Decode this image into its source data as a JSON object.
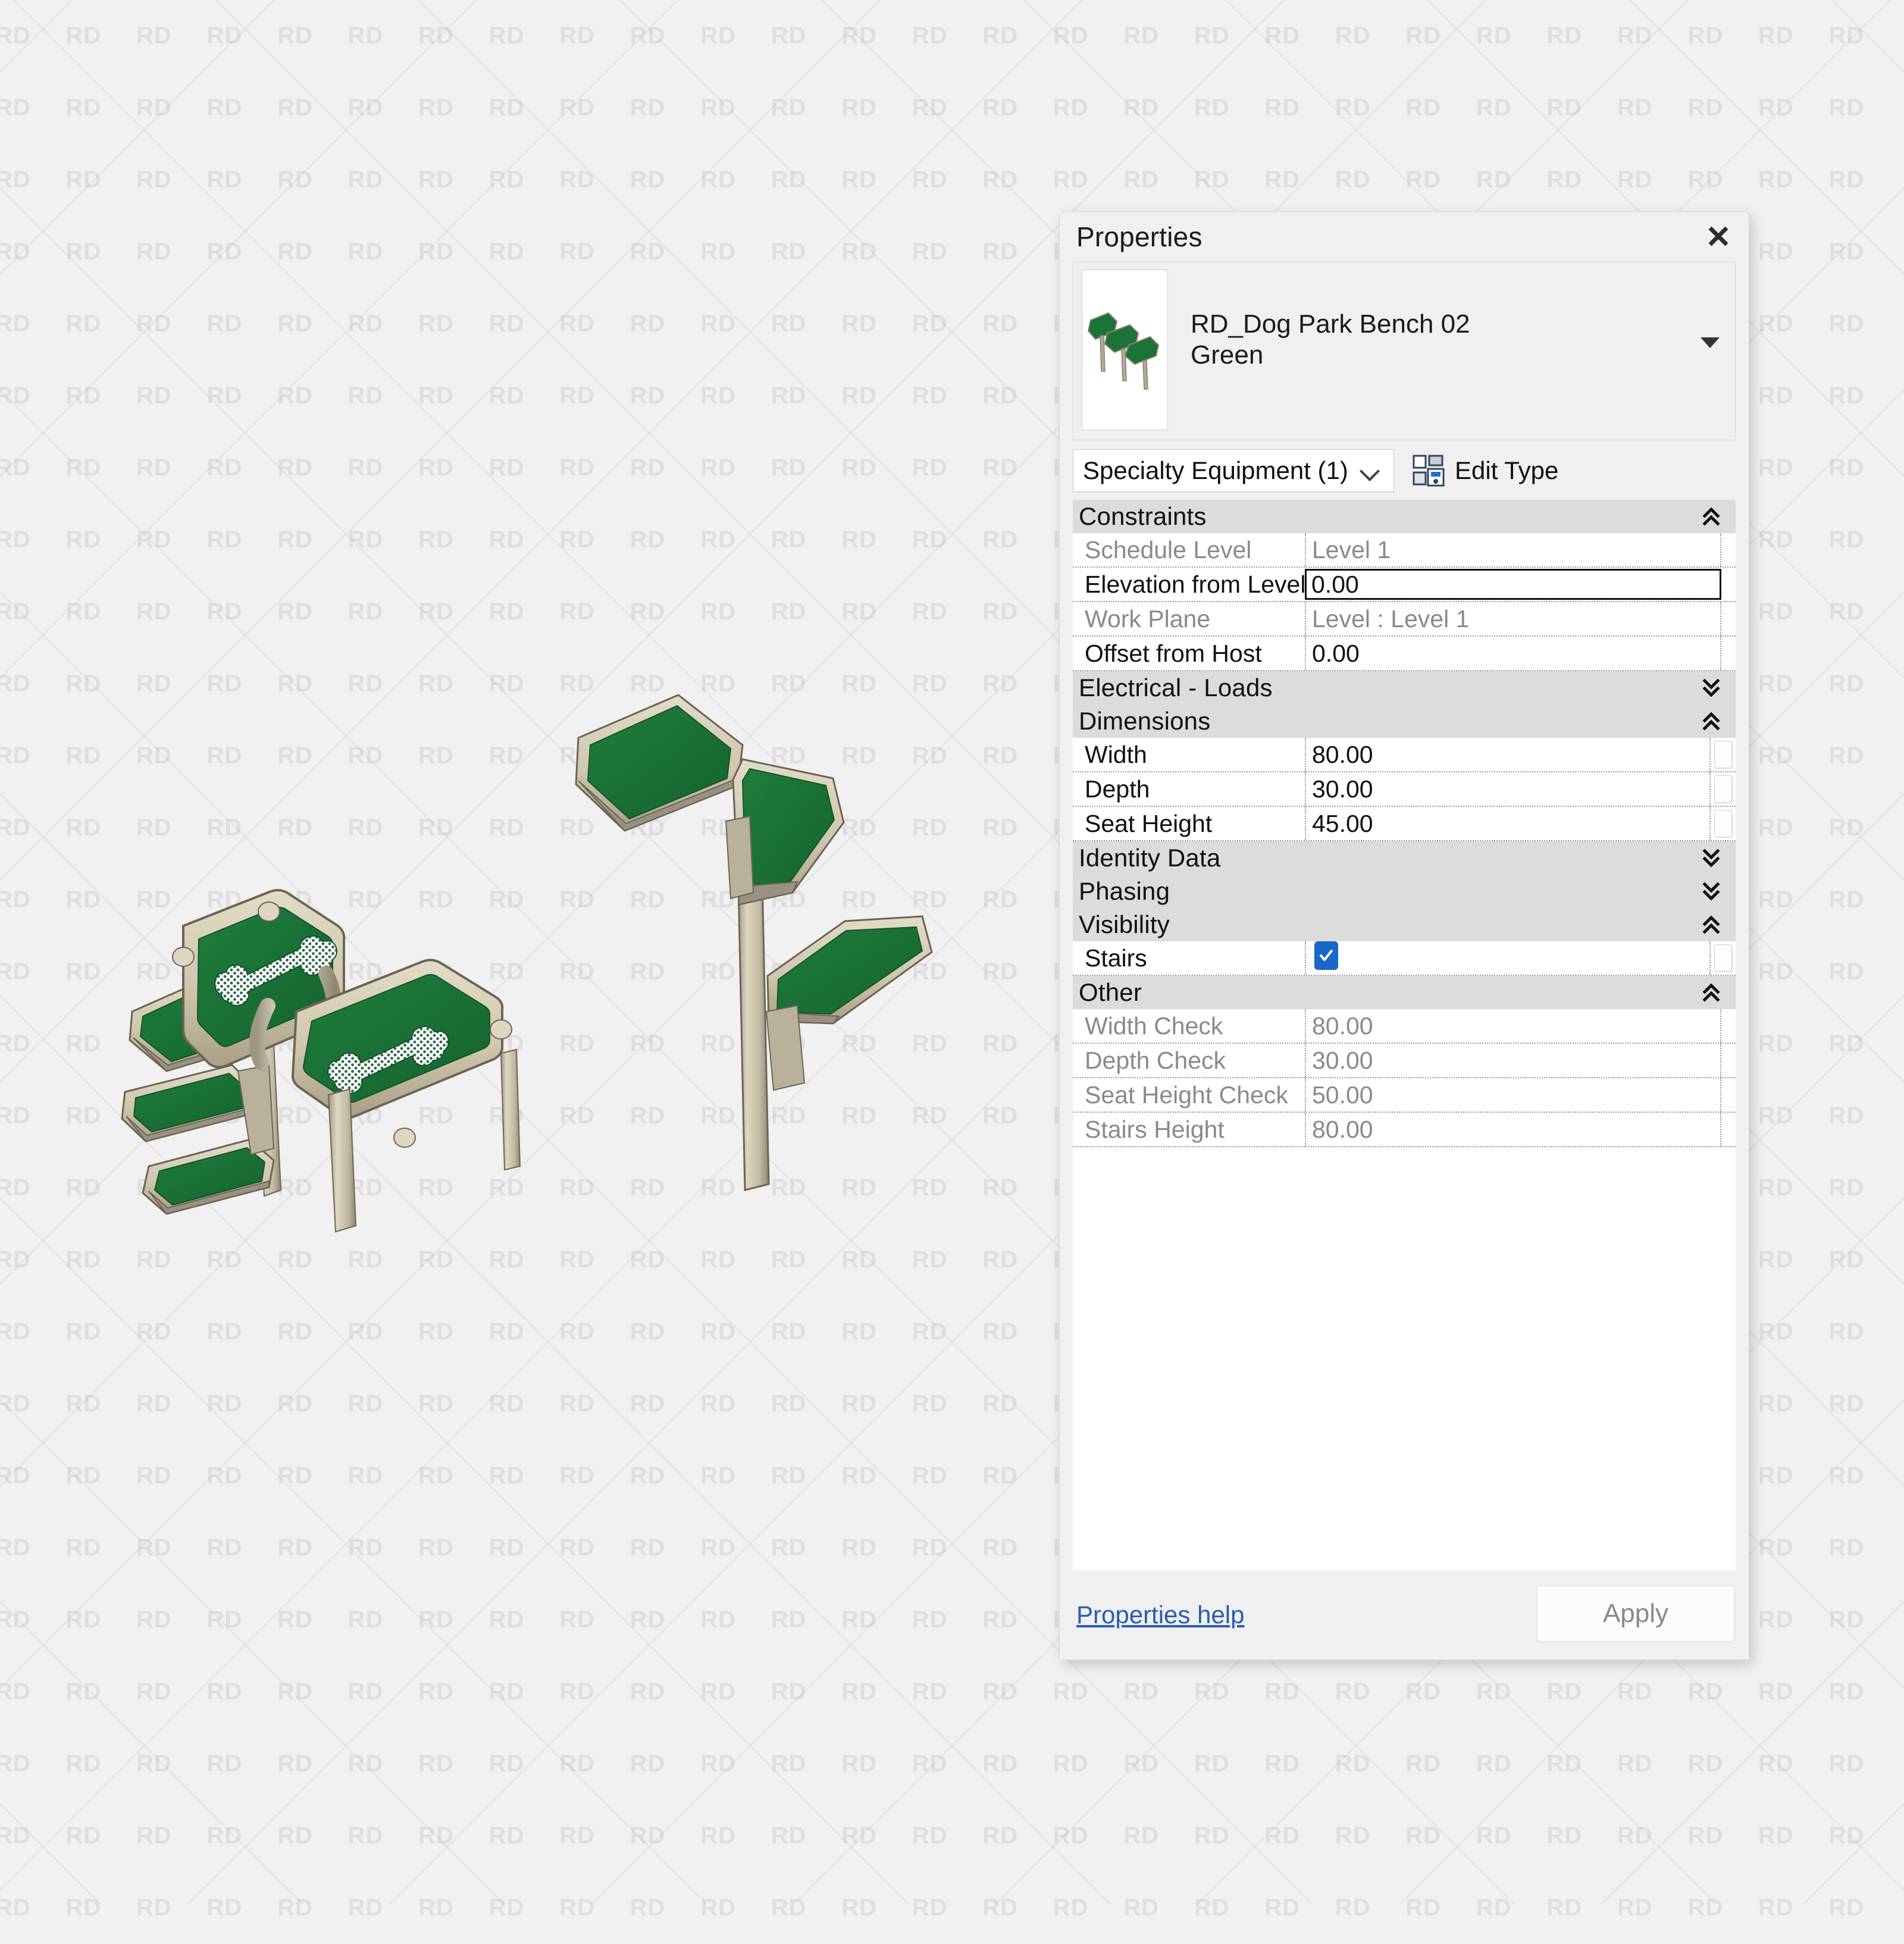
{
  "watermark": {
    "text": "RD"
  },
  "panel": {
    "title": "Properties",
    "close_icon": "close-icon",
    "preview": {
      "family_name": "RD_Dog Park Bench 02",
      "type_name": "Green",
      "caret_icon": "triangle-down-icon",
      "thumbnail_alt": "dog-park-bench-thumbnail"
    },
    "selector": {
      "category_value": "Specialty Equipment (1)",
      "chevron_icon": "chevron-down-icon",
      "edit_type_label": "Edit Type",
      "edit_type_icon": "edit-type-icon"
    },
    "groups": [
      {
        "name": "Constraints",
        "expanded": true,
        "chevron_icon": "double-chevron-up-icon",
        "rows": [
          {
            "name": "Schedule Level",
            "value": "Level 1",
            "readonly": true,
            "kind": "text"
          },
          {
            "name": "Elevation from Level",
            "value": "0.00",
            "readonly": false,
            "kind": "boxed"
          },
          {
            "name": "Work Plane",
            "value": "Level : Level 1",
            "readonly": true,
            "kind": "text"
          },
          {
            "name": "Offset from Host",
            "value": "0.00",
            "readonly": false,
            "kind": "text"
          }
        ]
      },
      {
        "name": "Electrical - Loads",
        "expanded": false,
        "chevron_icon": "double-chevron-down-icon",
        "rows": []
      },
      {
        "name": "Dimensions",
        "expanded": true,
        "chevron_icon": "double-chevron-up-icon",
        "rows": [
          {
            "name": "Width",
            "value": "80.00",
            "readonly": false,
            "kind": "assoc"
          },
          {
            "name": "Depth",
            "value": "30.00",
            "readonly": false,
            "kind": "assoc"
          },
          {
            "name": "Seat Height",
            "value": "45.00",
            "readonly": false,
            "kind": "assoc"
          }
        ]
      },
      {
        "name": "Identity Data",
        "expanded": false,
        "chevron_icon": "double-chevron-down-icon",
        "rows": []
      },
      {
        "name": "Phasing",
        "expanded": false,
        "chevron_icon": "double-chevron-down-icon",
        "rows": []
      },
      {
        "name": "Visibility",
        "expanded": true,
        "chevron_icon": "double-chevron-up-icon",
        "rows": [
          {
            "name": "Stairs",
            "value": "",
            "readonly": false,
            "kind": "checkbox",
            "checked": true
          }
        ]
      },
      {
        "name": "Other",
        "expanded": true,
        "chevron_icon": "double-chevron-up-icon",
        "rows": [
          {
            "name": "Width Check",
            "value": "80.00",
            "readonly": true,
            "kind": "text"
          },
          {
            "name": "Depth Check",
            "value": "30.00",
            "readonly": true,
            "kind": "text"
          },
          {
            "name": "Seat Height Check",
            "value": "50.00",
            "readonly": true,
            "kind": "text"
          },
          {
            "name": "Stairs Height",
            "value": "80.00",
            "readonly": true,
            "kind": "text"
          }
        ]
      }
    ],
    "footer": {
      "help_label": "Properties help",
      "apply_label": "Apply"
    }
  },
  "viewport": {
    "model_name": "RD_Dog Park Bench 02 Green",
    "colors": {
      "seat_green": "#1b7337",
      "frame_tan": "#cfc7ae",
      "frame_shade": "#a89f86",
      "outline": "#4d4a40",
      "background": "#f1f1f1",
      "accent_blue": "#1967c8",
      "link_blue": "#2a5db0",
      "group_header": "#dcdcdc"
    }
  }
}
